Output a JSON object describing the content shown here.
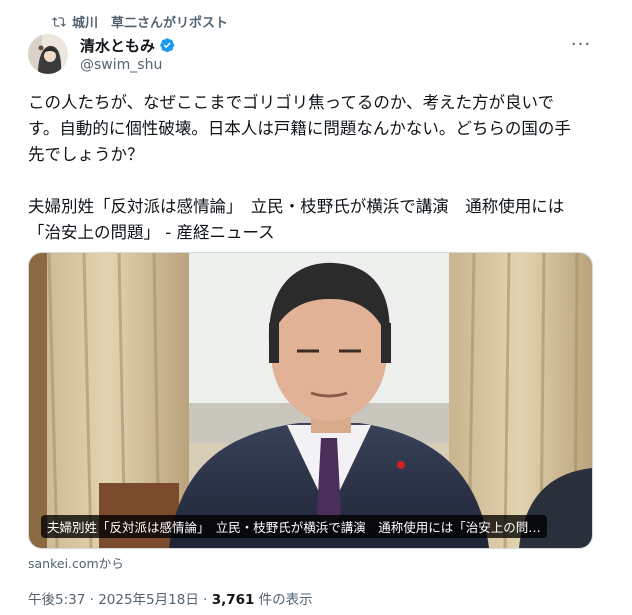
{
  "repost": {
    "text": "城川　草二さんがリポスト"
  },
  "author": {
    "name": "清水ともみ",
    "handle": "@swim_shu"
  },
  "more_icon": "more-dots-icon",
  "tweet": {
    "line1": "この人たちが、なぜここまでゴリゴリ焦ってるのか、考えた方が良いで",
    "line2": "す。自動的に個性破壊。日本人は戸籍に問題なんかない。どちらの国の手",
    "line3": "先でしょうか？",
    "line4": "夫婦別姓「反対派は感情論」　立民・枝野氏が横浜で講演　通称使用には",
    "line5": "「治安上の問題」 - 産経ニュース"
  },
  "card": {
    "title": "夫婦別姓「反対派は感情論」　立民・枝野氏が横浜で講演　通称使用には「治安上の問…",
    "source": "sankei.comから"
  },
  "meta": {
    "time": "午後5:37 · 2025年5月18日 · ",
    "views": "3,761",
    "views_label": " 件の表示"
  },
  "colors": {
    "text": "#0f1419",
    "secondary": "#536471",
    "verified": "#1d9bf0"
  }
}
